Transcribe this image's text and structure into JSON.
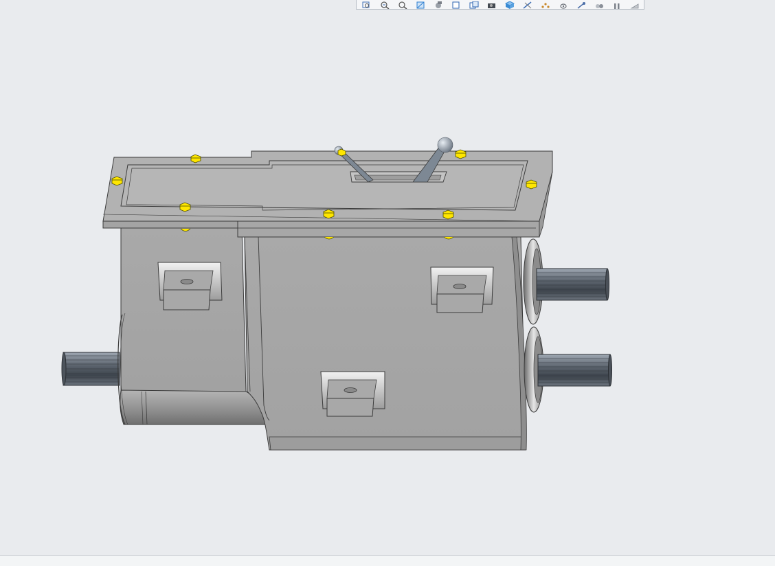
{
  "toolbar": {
    "buttons": [
      {
        "icon": "zoom-window-icon",
        "color": "#3f6fb5"
      },
      {
        "icon": "zoom-in-icon",
        "color": "#3f6fb5"
      },
      {
        "icon": "zoom-out-icon",
        "color": "#3f6fb5"
      },
      {
        "icon": "refit-icon",
        "color": "#2d7fd1"
      },
      {
        "icon": "repaint-icon",
        "color": "#7a7f88"
      },
      {
        "icon": "saved-views-icon",
        "color": "#2b63b0"
      },
      {
        "icon": "named-views-icon",
        "color": "#2b63b0"
      },
      {
        "icon": "display-style-icon",
        "color": "#444a52"
      },
      {
        "icon": "view-cube-icon",
        "color": "#3a8bd4"
      },
      {
        "icon": "sketch-view-icon",
        "color": "#3f6fb5"
      },
      {
        "icon": "datum-display-icon",
        "color": "#c8882a"
      },
      {
        "icon": "annotation-display-icon",
        "color": "#6b7078"
      },
      {
        "icon": "spin-center-icon",
        "color": "#4b6ea8"
      },
      {
        "icon": "model-tree-icon",
        "color": "#8a9099"
      },
      {
        "icon": "pause-icon",
        "color": "#7c828b"
      },
      {
        "icon": "more-icon",
        "color": "#8a9099"
      }
    ]
  },
  "viewport": {
    "background": "#e9ebee",
    "model": {
      "body_color": "#a6a6a6",
      "top_color": "#b9b9b9",
      "edge_color": "#3b3b3b",
      "bolt_color": "#ffe600",
      "shaft_color": "#5e6670",
      "knob_color": "#8c95a0"
    }
  }
}
